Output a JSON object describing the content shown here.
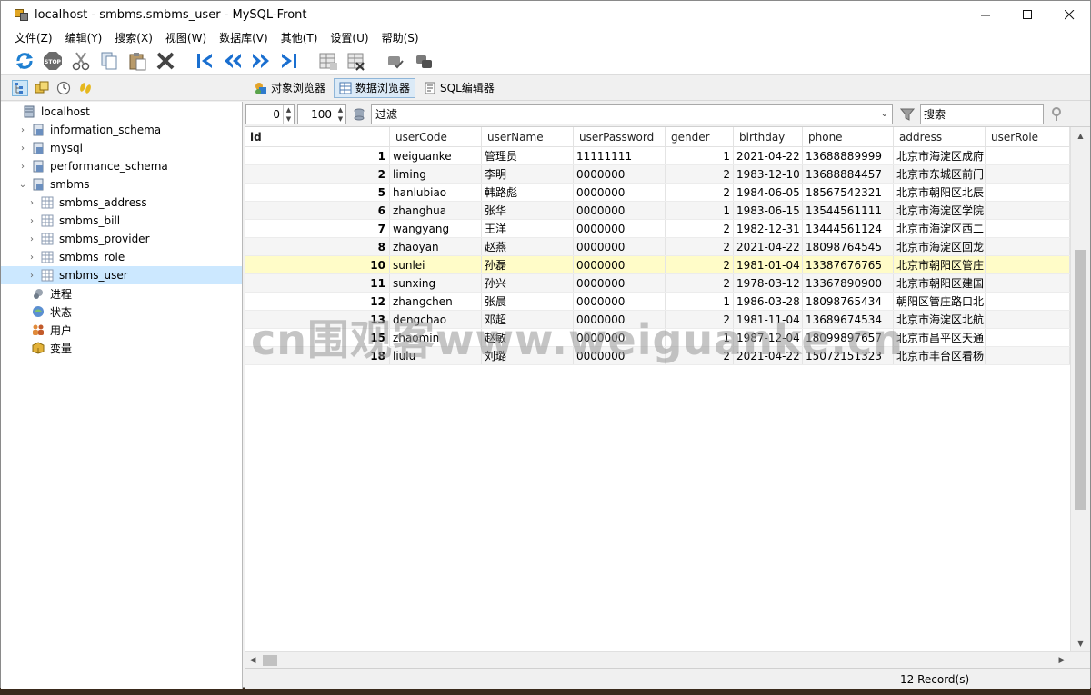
{
  "window": {
    "title": "localhost - smbms.smbms_user - MySQL-Front"
  },
  "menu": [
    "文件(Z)",
    "编辑(Y)",
    "搜索(X)",
    "视图(W)",
    "数据库(V)",
    "其他(T)",
    "设置(U)",
    "帮助(S)"
  ],
  "toolbar_icons": [
    "refresh-icon",
    "stop-icon",
    "cut-icon",
    "copy-icon",
    "paste-icon",
    "delete-icon",
    "first-icon",
    "prev-icon",
    "next-icon",
    "last-icon",
    "insert-row-icon",
    "delete-row-icon",
    "post-icon",
    "cancel-icon"
  ],
  "views": [
    {
      "label": "对象浏览器",
      "active": false
    },
    {
      "label": "数据浏览器",
      "active": true
    },
    {
      "label": "SQL编辑器",
      "active": false
    }
  ],
  "tree": [
    {
      "label": "localhost",
      "level": 0,
      "arrow": "",
      "icon": "server-icon"
    },
    {
      "label": "information_schema",
      "level": 1,
      "arrow": "›",
      "icon": "database-icon"
    },
    {
      "label": "mysql",
      "level": 1,
      "arrow": "›",
      "icon": "database-icon"
    },
    {
      "label": "performance_schema",
      "level": 1,
      "arrow": "›",
      "icon": "database-icon"
    },
    {
      "label": "smbms",
      "level": 1,
      "arrow": "⌄",
      "icon": "database-icon"
    },
    {
      "label": "smbms_address",
      "level": 2,
      "arrow": "›",
      "icon": "table-icon"
    },
    {
      "label": "smbms_bill",
      "level": 2,
      "arrow": "›",
      "icon": "table-icon"
    },
    {
      "label": "smbms_provider",
      "level": 2,
      "arrow": "›",
      "icon": "table-icon"
    },
    {
      "label": "smbms_role",
      "level": 2,
      "arrow": "›",
      "icon": "table-icon"
    },
    {
      "label": "smbms_user",
      "level": 2,
      "arrow": "›",
      "icon": "table-icon",
      "selected": true
    },
    {
      "label": "进程",
      "level": 1,
      "arrow": "",
      "icon": "process-icon"
    },
    {
      "label": "状态",
      "level": 1,
      "arrow": "",
      "icon": "status-icon"
    },
    {
      "label": "用户",
      "level": 1,
      "arrow": "",
      "icon": "users-icon"
    },
    {
      "label": "变量",
      "level": 1,
      "arrow": "",
      "icon": "variable-icon"
    }
  ],
  "filter": {
    "offset": "0",
    "limit": "100",
    "filter_placeholder": "过滤",
    "search_placeholder": "搜索"
  },
  "grid": {
    "columns": [
      "id",
      "userCode",
      "userName",
      "userPassword",
      "gender",
      "birthday",
      "phone",
      "address",
      "userRole"
    ],
    "rows": [
      [
        "1",
        "weiguanke",
        "管理员",
        "11111111",
        "1",
        "2021-04-22",
        "13688889999",
        "北京市海淀区成府"
      ],
      [
        "2",
        "liming",
        "李明",
        "0000000",
        "2",
        "1983-12-10",
        "13688884457",
        "北京市东城区前门"
      ],
      [
        "5",
        "hanlubiao",
        "韩路彪",
        "0000000",
        "2",
        "1984-06-05",
        "18567542321",
        "北京市朝阳区北辰"
      ],
      [
        "6",
        "zhanghua",
        "张华",
        "0000000",
        "1",
        "1983-06-15",
        "13544561111",
        "北京市海淀区学院"
      ],
      [
        "7",
        "wangyang",
        "王洋",
        "0000000",
        "2",
        "1982-12-31",
        "13444561124",
        "北京市海淀区西二"
      ],
      [
        "8",
        "zhaoyan",
        "赵燕",
        "0000000",
        "2",
        "2021-04-22",
        "18098764545",
        "北京市海淀区回龙"
      ],
      [
        "10",
        "sunlei",
        "孙磊",
        "0000000",
        "2",
        "1981-01-04",
        "13387676765",
        "北京市朝阳区管庄"
      ],
      [
        "11",
        "sunxing",
        "孙兴",
        "0000000",
        "2",
        "1978-03-12",
        "13367890900",
        "北京市朝阳区建国"
      ],
      [
        "12",
        "zhangchen",
        "张晨",
        "0000000",
        "1",
        "1986-03-28",
        "18098765434",
        "朝阳区管庄路口北"
      ],
      [
        "13",
        "dengchao",
        "邓超",
        "0000000",
        "2",
        "1981-11-04",
        "13689674534",
        "北京市海淀区北航"
      ],
      [
        "15",
        "zhaomin",
        "赵敏",
        "0000000",
        "1",
        "1987-12-04",
        "18099897657",
        "北京市昌平区天通"
      ],
      [
        "18",
        "liulu",
        "刘璐",
        "0000000",
        "2",
        "2021-04-22",
        "15072151323",
        "北京市丰台区看杨"
      ]
    ],
    "selected_row": 6
  },
  "status": {
    "records": "12 Record(s)"
  },
  "watermark": "cn围观客www.weiguanke.cn"
}
